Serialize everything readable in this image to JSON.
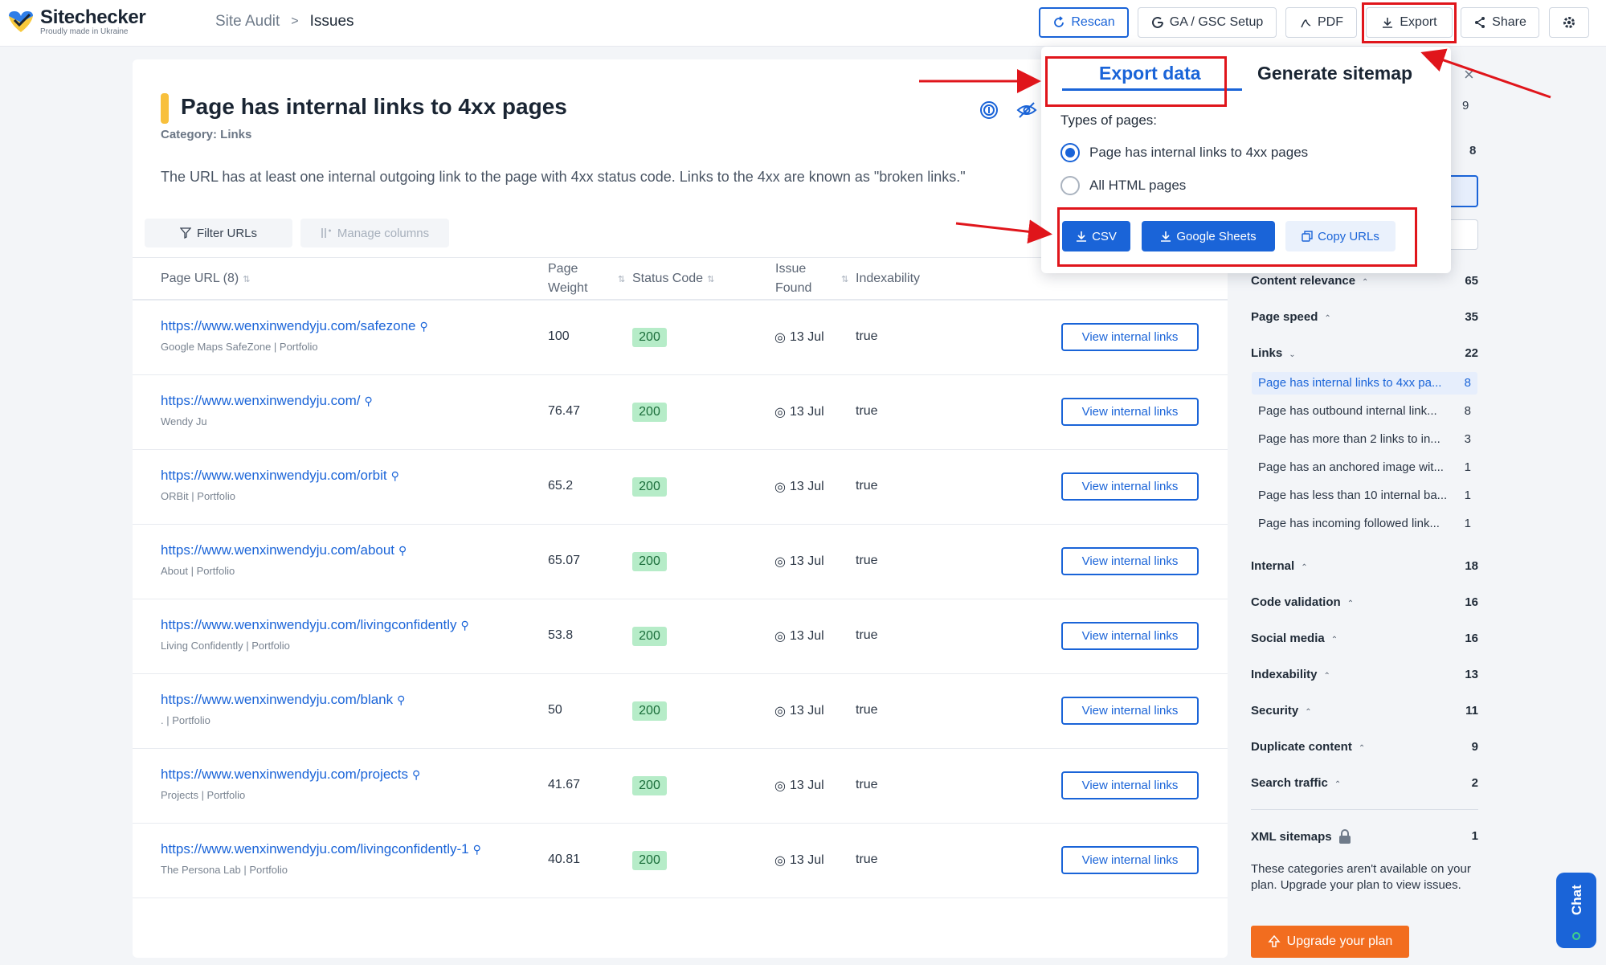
{
  "header": {
    "logo_name": "Sitechecker",
    "logo_sub": "Proudly made in Ukraine",
    "breadcrumb_root": "Site Audit",
    "breadcrumb_sep": ">",
    "breadcrumb_current": "Issues",
    "buttons": {
      "rescan": "Rescan",
      "ga_gsc": "GA / GSC Setup",
      "pdf": "PDF",
      "export": "Export",
      "share": "Share"
    }
  },
  "issue": {
    "title": "Page has internal links to 4xx pages",
    "category": "Category: Links",
    "description": "The URL has at least one internal outgoing link to the page with 4xx status code. Links to the 4xx are known as \"broken links.\""
  },
  "toolbar": {
    "filter": "Filter URLs",
    "manage_columns": "Manage columns"
  },
  "table": {
    "headers": {
      "url": "Page URL (8)",
      "weight_1": "Page",
      "weight_2": "Weight",
      "status": "Status Code",
      "found_1": "Issue",
      "found_2": "Found",
      "indexability": "Indexability"
    },
    "view_button": "View internal links",
    "rows": [
      {
        "url": "https://www.wenxinwendyju.com/safezone",
        "page_title": "Google Maps SafeZone | Portfolio",
        "weight": "100",
        "status": "200",
        "found": "13 Jul",
        "indexable": "true"
      },
      {
        "url": "https://www.wenxinwendyju.com/",
        "page_title": "Wendy Ju",
        "weight": "76.47",
        "status": "200",
        "found": "13 Jul",
        "indexable": "true"
      },
      {
        "url": "https://www.wenxinwendyju.com/orbit",
        "page_title": "ORBit | Portfolio",
        "weight": "65.2",
        "status": "200",
        "found": "13 Jul",
        "indexable": "true"
      },
      {
        "url": "https://www.wenxinwendyju.com/about",
        "page_title": "About | Portfolio",
        "weight": "65.07",
        "status": "200",
        "found": "13 Jul",
        "indexable": "true"
      },
      {
        "url": "https://www.wenxinwendyju.com/livingconfidently",
        "page_title": "Living Confidently | Portfolio",
        "weight": "53.8",
        "status": "200",
        "found": "13 Jul",
        "indexable": "true"
      },
      {
        "url": "https://www.wenxinwendyju.com/blank",
        "page_title": ". | Portfolio",
        "weight": "50",
        "status": "200",
        "found": "13 Jul",
        "indexable": "true"
      },
      {
        "url": "https://www.wenxinwendyju.com/projects",
        "page_title": "Projects | Portfolio",
        "weight": "41.67",
        "status": "200",
        "found": "13 Jul",
        "indexable": "true"
      },
      {
        "url": "https://www.wenxinwendyju.com/livingconfidently-1",
        "page_title": "The Persona Lab | Portfolio",
        "weight": "40.81",
        "status": "200",
        "found": "13 Jul",
        "indexable": "true"
      }
    ]
  },
  "sidebar": {
    "hidden_counts": [
      "9",
      "8"
    ],
    "categories_top": [
      {
        "label": "Content relevance",
        "count": "65"
      },
      {
        "label": "Page speed",
        "count": "35"
      },
      {
        "label": "Links",
        "count": "22"
      }
    ],
    "link_items": [
      {
        "label": "Page has internal links to 4xx pa...",
        "count": "8"
      },
      {
        "label": "Page has outbound internal link...",
        "count": "8"
      },
      {
        "label": "Page has more than 2 links to in...",
        "count": "3"
      },
      {
        "label": "Page has an anchored image wit...",
        "count": "1"
      },
      {
        "label": "Page has less than 10 internal ba...",
        "count": "1"
      },
      {
        "label": "Page has incoming followed link...",
        "count": "1"
      }
    ],
    "categories_bottom": [
      {
        "label": "Internal",
        "count": "18"
      },
      {
        "label": "Code validation",
        "count": "16"
      },
      {
        "label": "Social media",
        "count": "16"
      },
      {
        "label": "Indexability",
        "count": "13"
      },
      {
        "label": "Security",
        "count": "11"
      },
      {
        "label": "Duplicate content",
        "count": "9"
      },
      {
        "label": "Search traffic",
        "count": "2"
      }
    ],
    "xml_label": "XML sitemaps",
    "xml_count": "1",
    "plan_note": "These categories aren't available on your plan. Upgrade your plan to view issues.",
    "upgrade": "Upgrade your plan",
    "chat": "Chat"
  },
  "export_popup": {
    "tab_export": "Export data",
    "tab_sitemap": "Generate sitemap",
    "types_label": "Types of pages:",
    "option_issue": "Page has internal links to 4xx pages",
    "option_all": "All HTML pages",
    "csv": "CSV",
    "google_sheets": "Google Sheets",
    "copy_urls": "Copy URLs"
  },
  "colors": {
    "accent": "#1a64d8",
    "status_ok_bg": "#b6ecc8",
    "upgrade": "#f26d1f",
    "annotation_red": "#e0151b",
    "title_marker": "#f8c03c"
  }
}
